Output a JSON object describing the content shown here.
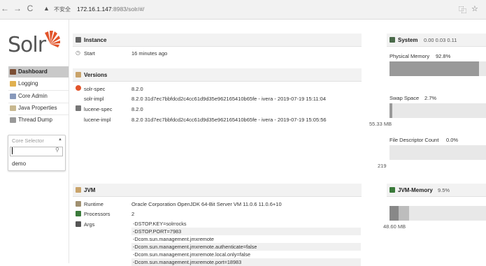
{
  "browser": {
    "warning_label": "不安全",
    "url_host": "172.16.1.147",
    "url_rest": ":8983/solr/#/"
  },
  "logo": {
    "text": "Solr"
  },
  "sidebar": {
    "items": [
      {
        "label": "Dashboard",
        "icon": "dashboard-icon",
        "color": "#8a5a3a",
        "active": true
      },
      {
        "label": "Logging",
        "icon": "logging-icon",
        "color": "#e0b050"
      },
      {
        "label": "Core Admin",
        "icon": "core-admin-icon",
        "color": "#8899bb"
      },
      {
        "label": "Java Properties",
        "icon": "java-properties-icon",
        "color": "#c8b890"
      },
      {
        "label": "Thread Dump",
        "icon": "thread-dump-icon",
        "color": "#999999"
      }
    ],
    "core_selector": {
      "placeholder": "Core Selector",
      "options": [
        "demo"
      ]
    }
  },
  "instance": {
    "title": "Instance",
    "start_label": "Start",
    "start_value": "16 minutes ago"
  },
  "versions": {
    "title": "Versions",
    "rows": [
      {
        "label": "solr-spec",
        "value": "8.2.0"
      },
      {
        "label": "solr-impl",
        "value": "8.2.0 31d7ec7bbfdcd2c4cc61d9d35e962165410b65fe - ivera - 2019-07-19 15:11:04"
      },
      {
        "label": "lucene-spec",
        "value": "8.2.0"
      },
      {
        "label": "lucene-impl",
        "value": "8.2.0 31d7ec7bbfdcd2c4cc61d9d35e962165410b65fe - ivera - 2019-07-19 15:05:56"
      }
    ]
  },
  "jvm": {
    "title": "JVM",
    "runtime_label": "Runtime",
    "runtime_value": "Oracle Corporation OpenJDK 64-Bit Server VM 11.0.6 11.0.6+10",
    "processors_label": "Processors",
    "processors_value": "2",
    "args_label": "Args",
    "args": [
      "-DSTOP.KEY=solrrocks",
      "-DSTOP.PORT=7983",
      "-Dcom.sun.management.jmxremote",
      "-Dcom.sun.management.jmxremote.authenticate=false",
      "-Dcom.sun.management.jmxremote.local.only=false",
      "-Dcom.sun.management.jmxremote.port=18983"
    ]
  },
  "system": {
    "title": "System",
    "load": "0.00 0.03 0.11",
    "physical_memory_label": "Physical Memory",
    "physical_memory_pct": "92.8%",
    "physical_memory_fraction": 0.928,
    "swap_label": "Swap Space",
    "swap_pct": "2.7%",
    "swap_fraction": 0.027,
    "swap_side_value": "55.33 MB",
    "fd_label": "File Descriptor Count",
    "fd_pct": "0.0%",
    "fd_fraction": 0.0,
    "fd_side_value": "219"
  },
  "jvm_memory": {
    "title": "JVM-Memory",
    "pct": "9.5%",
    "used_fraction": 0.095,
    "committed_fraction": 0.2,
    "side_value": "48.60 MB"
  }
}
